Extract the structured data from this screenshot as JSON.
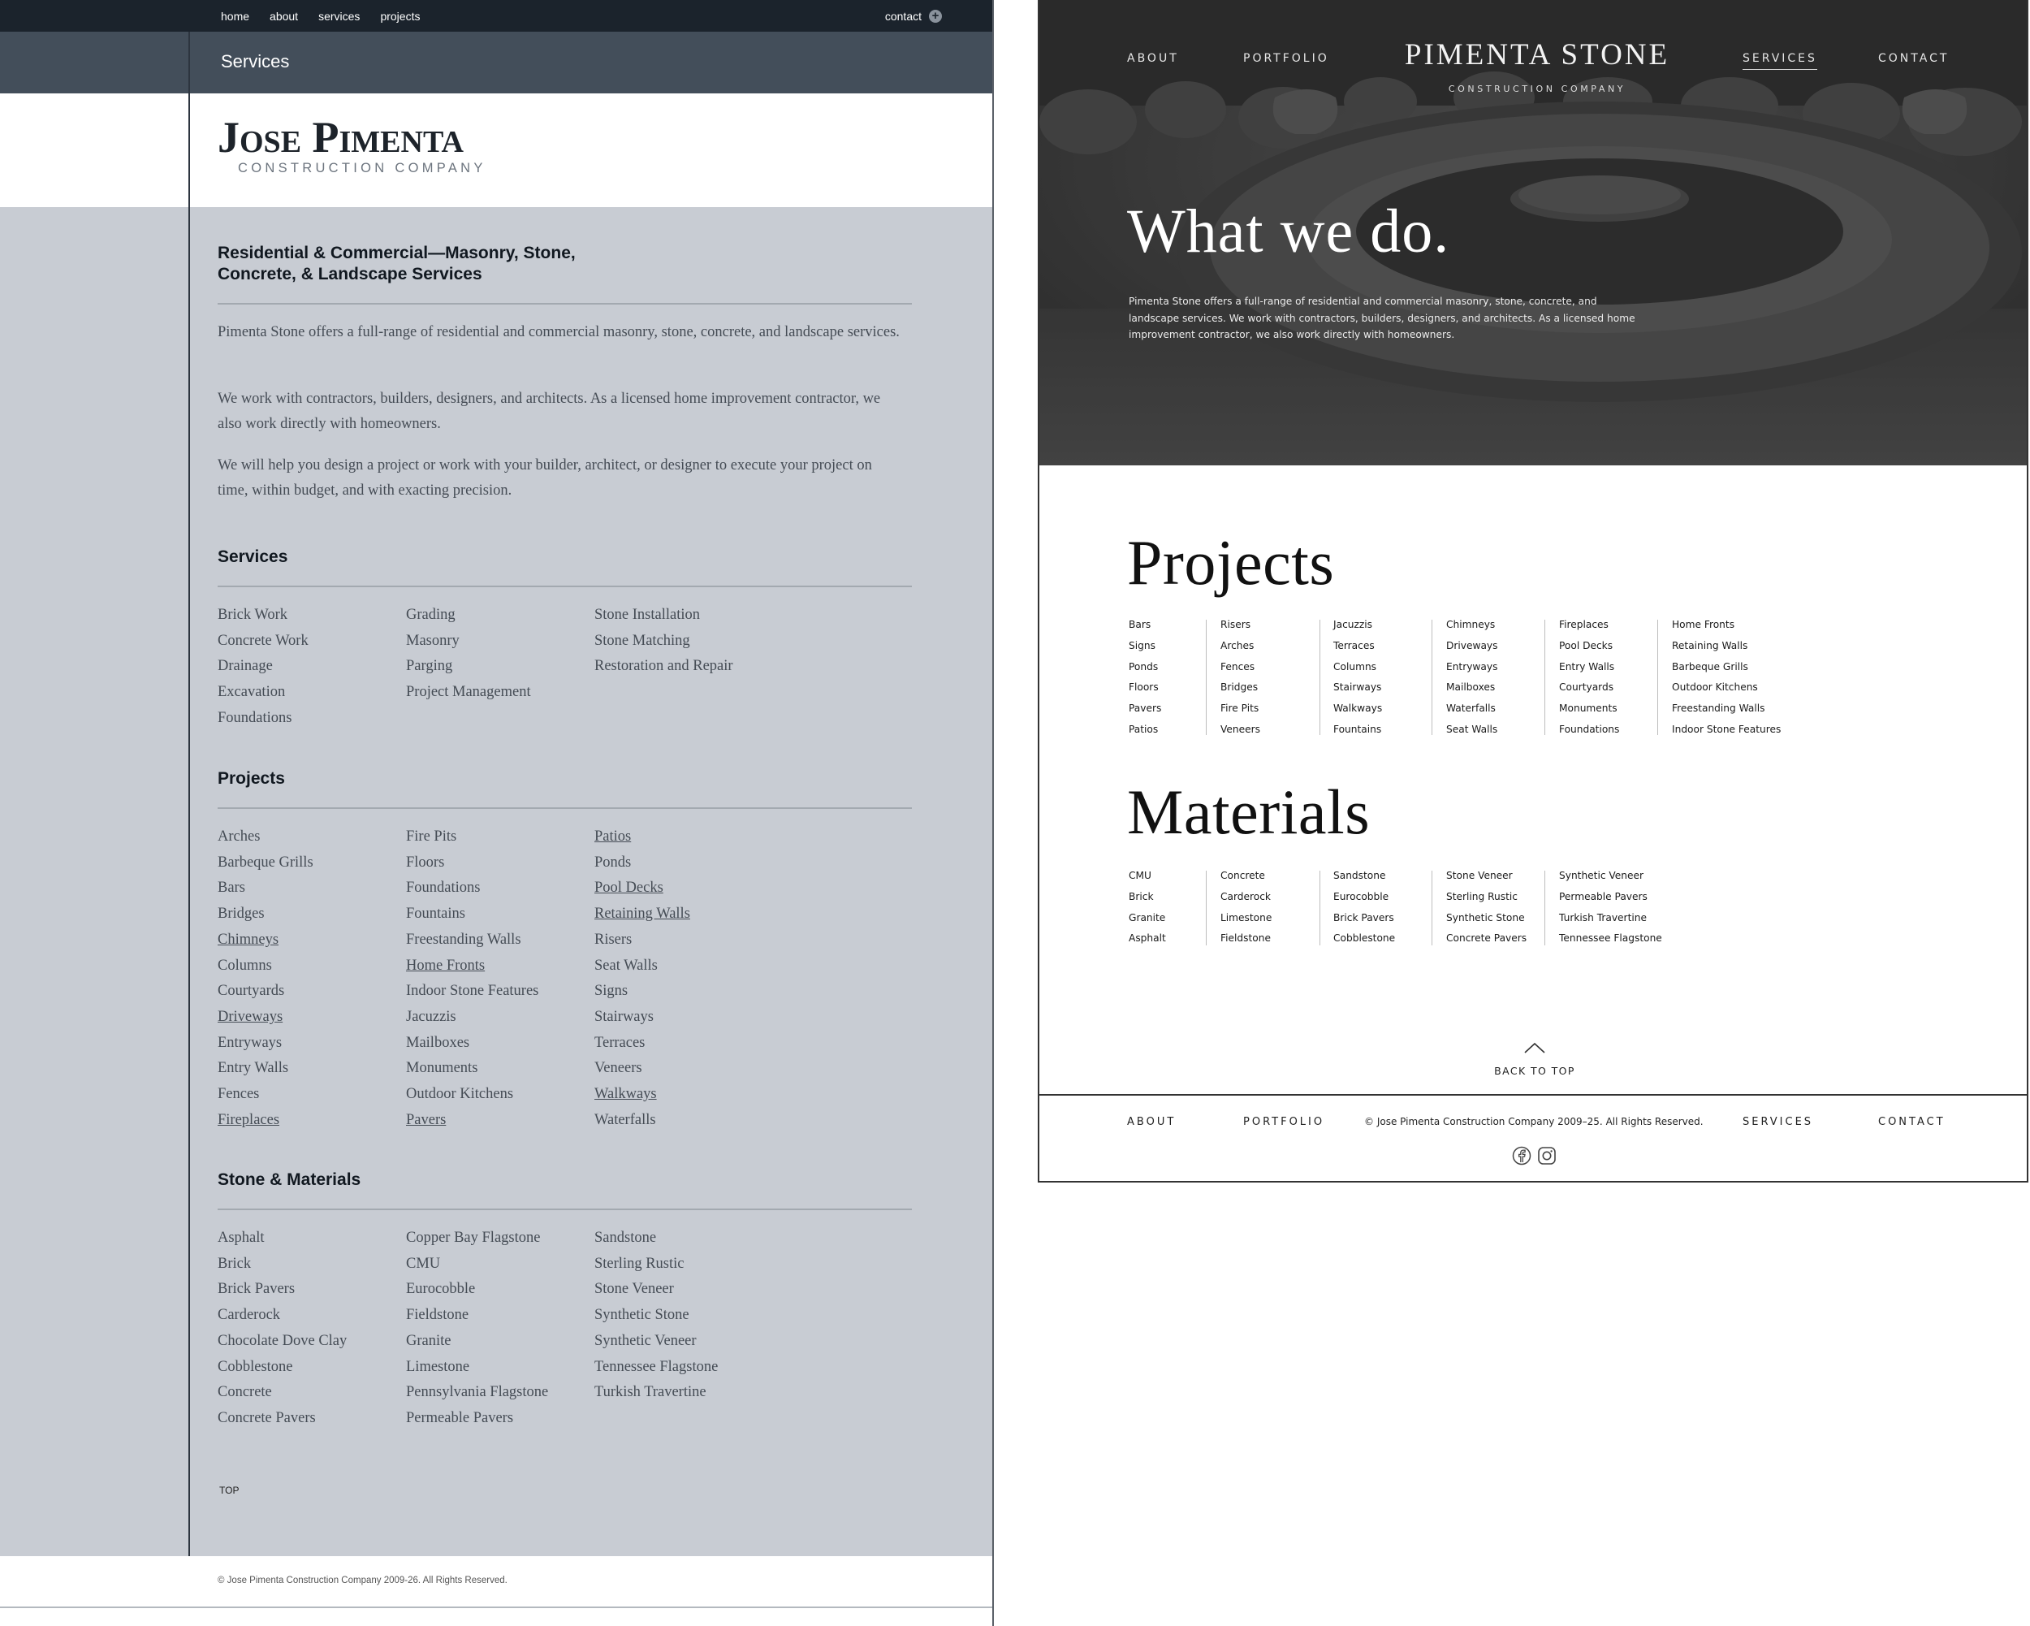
{
  "old_site": {
    "topnav": [
      "home",
      "about",
      "services",
      "projects"
    ],
    "contact": "contact",
    "contact_icon": "plus-circle-icon",
    "title_bar": "Services",
    "logo": {
      "main": "Jose Pimenta",
      "sub": "CONSTRUCTION COMPANY"
    },
    "heading": "Residential & Commercial—Masonry, Stone, Concrete, & Landscape Services",
    "paragraphs": [
      "Pimenta Stone offers a full-range of residential and commercial masonry, stone, concrete, and landscape services.",
      "We work with contractors, builders, designers, and architects. As a licensed home improvement contractor, we also work directly with homeowners.",
      "We will help you design a project or work with your builder, architect, or designer to execute your project on time, within budget, and with exacting precision."
    ],
    "services": {
      "title": "Services",
      "columns": [
        [
          "Brick Work",
          "Concrete Work",
          "Drainage",
          "Excavation",
          "Foundations"
        ],
        [
          "Grading",
          "Masonry",
          "Parging",
          "Project Management"
        ],
        [
          "Stone Installation",
          "Stone Matching",
          "Restoration and Repair"
        ]
      ]
    },
    "projects": {
      "title": "Projects",
      "columns": [
        [
          "Arches",
          "Barbeque Grills",
          "Bars",
          "Bridges",
          "Chimneys",
          "Columns",
          "Courtyards",
          "Driveways",
          "Entryways",
          "Entry Walls",
          "Fences",
          "Fireplaces"
        ],
        [
          "Fire Pits",
          "Floors",
          "Foundations",
          "Fountains",
          "Freestanding Walls",
          "Home Fronts",
          "Indoor Stone Features",
          "Jacuzzis",
          "Mailboxes",
          "Monuments",
          "Outdoor Kitchens",
          "Pavers"
        ],
        [
          "Patios",
          "Ponds",
          "Pool Decks",
          "Retaining Walls",
          "Risers",
          "Seat Walls",
          "Signs",
          "Stairways",
          "Terraces",
          "Veneers",
          "Walkways",
          "Waterfalls"
        ]
      ],
      "links": [
        "Chimneys",
        "Driveways",
        "Fireplaces",
        "Home Fronts",
        "Pavers",
        "Patios",
        "Pool Decks",
        "Retaining Walls",
        "Walkways"
      ]
    },
    "materials": {
      "title": "Stone & Materials",
      "columns": [
        [
          "Asphalt",
          "Brick",
          "Brick Pavers",
          "Carderock",
          "Chocolate Dove Clay",
          "Cobblestone",
          "Concrete",
          "Concrete Pavers"
        ],
        [
          "Copper Bay Flagstone",
          "CMU",
          "Eurocobble",
          "Fieldstone",
          "Granite",
          "Limestone",
          "Pennsylvania Flagstone",
          "Permeable Pavers"
        ],
        [
          "Sandstone",
          "Sterling Rustic",
          "Stone Veneer",
          "Synthetic Stone",
          "Synthetic Veneer",
          "Tennessee Flagstone",
          "Turkish Travertine"
        ]
      ]
    },
    "top_link": "TOP",
    "copyright": "© Jose Pimenta Construction Company 2009-26. All Rights Reserved."
  },
  "new_site": {
    "nav": {
      "about": "ABOUT",
      "portfolio": "PORTFOLIO",
      "services": "SERVICES",
      "contact": "CONTACT"
    },
    "brand": "PIMENTA STONE",
    "brand_sub": "CONSTRUCTION COMPANY",
    "hero_title": "What we do.",
    "hero_text": "Pimenta Stone offers a full-range of residential and commercial masonry, stone, concrete, and landscape services. We work with contractors, builders, designers, and architects. As a licensed home improvement contractor, we also work directly with homeowners.",
    "projects": {
      "title": "Projects",
      "columns": [
        [
          "Bars",
          "Signs",
          "Ponds",
          "Floors",
          "Pavers",
          "Patios"
        ],
        [
          "Risers",
          "Arches",
          "Fences",
          "Bridges",
          "Fire Pits",
          "Veneers"
        ],
        [
          "Jacuzzis",
          "Terraces",
          "Columns",
          "Stairways",
          "Walkways",
          "Fountains"
        ],
        [
          "Chimneys",
          "Driveways",
          "Entryways",
          "Mailboxes",
          "Waterfalls",
          "Seat Walls"
        ],
        [
          "Fireplaces",
          "Pool Decks",
          "Entry Walls",
          "Courtyards",
          "Monuments",
          "Foundations"
        ],
        [
          "Home Fronts",
          "Retaining Walls",
          "Barbeque Grills",
          "Outdoor Kitchens",
          "Freestanding Walls",
          "Indoor Stone Features"
        ]
      ]
    },
    "materials": {
      "title": "Materials",
      "columns": [
        [
          "CMU",
          "Brick",
          "Granite",
          "Asphalt"
        ],
        [
          "Concrete",
          "Carderock",
          "Limestone",
          "Fieldstone"
        ],
        [
          "Sandstone",
          "Eurocobble",
          "Brick Pavers",
          "Cobblestone"
        ],
        [
          "Stone Veneer",
          "Sterling Rustic",
          "Synthetic Stone",
          "Concrete Pavers"
        ],
        [
          "Synthetic Veneer",
          "Permeable Pavers",
          "Turkish Travertine",
          "Tennessee Flagstone"
        ]
      ]
    },
    "back_to_top": "BACK TO TOP",
    "back_to_top_icon": "chevron-up-icon",
    "copyright": "© Jose Pimenta Construction Company 2009–25. All Rights Reserved.",
    "social_icons": [
      "facebook-icon",
      "instagram-icon"
    ],
    "colors": {
      "hero_overlay": "#3a3a3a",
      "old_bg": "#c8ccd3",
      "old_nav": "#1b232c",
      "old_titlebar": "#434e5a"
    }
  }
}
